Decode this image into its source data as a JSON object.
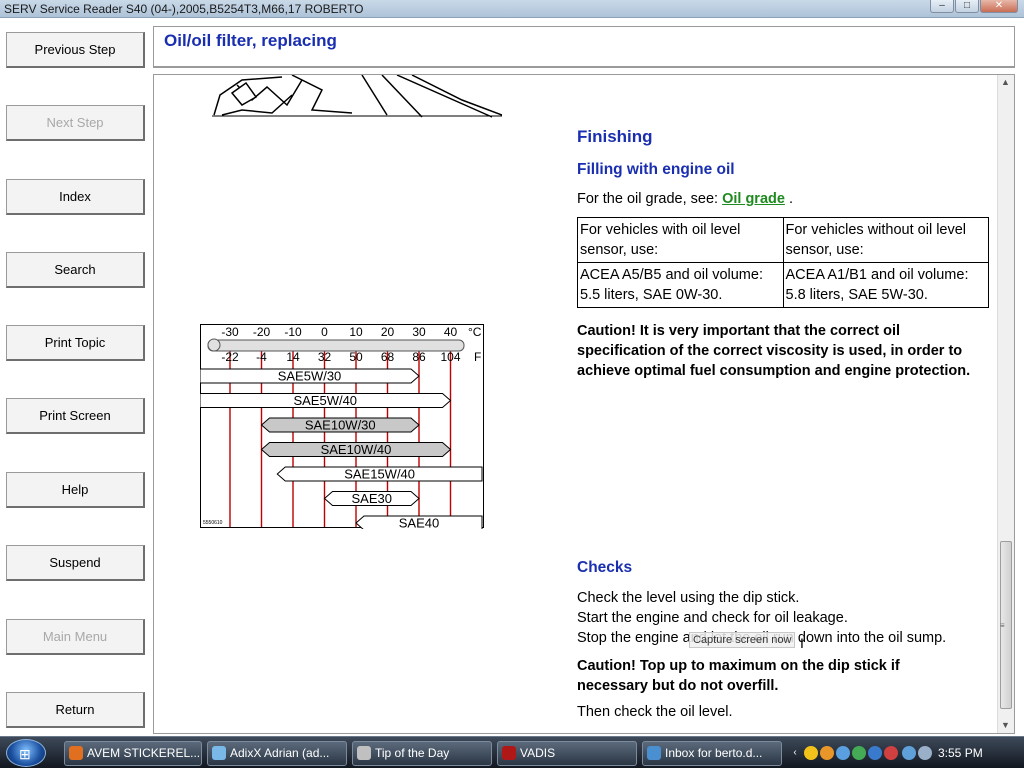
{
  "window": {
    "title": "SERV Service Reader S40 (04-),2005,B5254T3,M66,17 ROBERTO"
  },
  "nav": {
    "previous_step": "Previous Step",
    "next_step": "Next Step",
    "index": "Index",
    "search": "Search",
    "print_topic": "Print Topic",
    "print_screen": "Print Screen",
    "help": "Help",
    "suspend": "Suspend",
    "main_menu": "Main Menu",
    "return": "Return"
  },
  "header": {
    "title": "Oil/oil filter, replacing"
  },
  "content": {
    "finishing": "Finishing",
    "filling": "Filling with engine oil",
    "oil_grade_prefix": "For the oil grade, see: ",
    "oil_grade_link": "Oil grade",
    "oil_grade_suffix": " .",
    "table": {
      "h1": "For vehicles with oil level sensor, use:",
      "h2": "For vehicles without oil level sensor, use:",
      "c1": "ACEA A5/B5 and oil volume: 5.5 liters, SAE 0W-30.",
      "c2": "ACEA A1/B1 and oil volume: 5.8 liters, SAE 5W-30."
    },
    "caution1_label": "Caution!",
    "caution1_text": " It is very important that the correct oil specification of the correct viscosity is used, in order to achieve optimal fuel consumption and engine protection.",
    "checks": "Checks",
    "check_line1": "Check the level using the dip stick.",
    "check_line2": "Start the engine and check for oil leakage.",
    "check_line3": "Stop the engine and let the oil run down into the oil sump.",
    "caution2_label": "Caution!",
    "caution2_text": " Top up to maximum on the dip stick if necessary but do not overfill.",
    "then_check": "Then check the oil level.",
    "tooltip": "Capture screen now"
  },
  "viscosity_chart": {
    "celsius_ticks": [
      "-30",
      "-20",
      "-10",
      "0",
      "10",
      "20",
      "30",
      "40"
    ],
    "celsius_unit": "°C",
    "fahrenheit_ticks": [
      "-22",
      "-4",
      "14",
      "32",
      "50",
      "68",
      "86",
      "104"
    ],
    "fahrenheit_unit": "F",
    "grades": [
      {
        "name": "SAE5W/30",
        "from": -40,
        "to": 30,
        "shaded": false
      },
      {
        "name": "SAE5W/40",
        "from": -40,
        "to": 40,
        "shaded": false
      },
      {
        "name": "SAE10W/30",
        "from": -20,
        "to": 30,
        "shaded": true
      },
      {
        "name": "SAE10W/40",
        "from": -20,
        "to": 40,
        "shaded": true
      },
      {
        "name": "SAE15W/40",
        "from": -15,
        "to": 50,
        "shaded": false
      },
      {
        "name": "SAE30",
        "from": 0,
        "to": 30,
        "shaded": false
      },
      {
        "name": "SAE40",
        "from": 10,
        "to": 50,
        "shaded": false
      }
    ]
  },
  "taskbar": {
    "tasks": [
      {
        "label": "AVEM STICKEREL...",
        "color": "#e07020"
      },
      {
        "label": "AdixX Adrian (ad...",
        "color": "#7ab8e8"
      },
      {
        "label": "Tip of the Day",
        "color": "#c0c0c0"
      },
      {
        "label": "VADIS",
        "color": "#b01818"
      },
      {
        "label": "Inbox for berto.d...",
        "color": "#4a90d0"
      }
    ],
    "clock": "3:55 PM"
  },
  "colors": {
    "heading": "#1a2fb0",
    "link": "#1f8a1f"
  }
}
